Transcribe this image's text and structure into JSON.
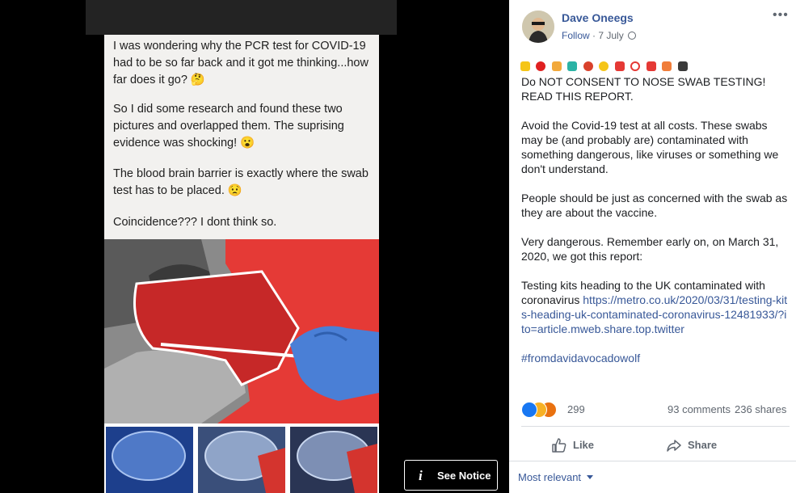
{
  "image_text": {
    "p1": "I was wondering why the PCR test for COVID-19 had to be so far back and it got me thinking...how far does it go? 🤔",
    "p2": "So I  did some research and found these two pictures and overlapped them. The suprising evidence was shocking! 😮",
    "p3": "The blood brain barrier is exactly where the swab test has to be placed. 😟",
    "p4": "Coincidence??? I dont think so."
  },
  "notice": {
    "label": "See Notice",
    "icon": "info-icon"
  },
  "post": {
    "author": "Dave Oneegs",
    "follow": "Follow",
    "date": "7 July",
    "privacy_icon": "globe-icon",
    "more_icon": "more-options-icon",
    "line1": "Do NOT CONSENT TO NOSE SWAB TESTING!",
    "line2": "READ THIS REPORT.",
    "para2": "Avoid the Covid-19 test at all costs. These swabs may be (and probably are) contaminated with something dangerous, like viruses or something we don't understand.",
    "para3": "People should be just as concerned with the swab as they are about the vaccine.",
    "para4": "Very dangerous. Remember early on, on March 31, 2020, we got this report:",
    "para5_text": "Testing kits heading to the UK contaminated with coronavirus ",
    "para5_link": "https://metro.co.uk/2020/03/31/testing-kits-heading-uk-contaminated-coronavirus-12481933/?ito=article.mweb.share.top.twitter",
    "hashtag": "#fromdavidavocadowolf"
  },
  "stats": {
    "reactions": "299",
    "comments": "93 comments",
    "shares": "236 shares"
  },
  "actions": {
    "like": "Like",
    "share": "Share"
  },
  "sort": {
    "label": "Most relevant"
  },
  "colors": {
    "link": "#385898",
    "illustration_red": "#e53a36",
    "glove_blue": "#4a7fd6"
  }
}
